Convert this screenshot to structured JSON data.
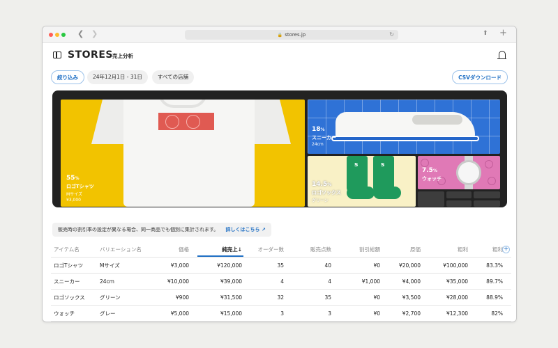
{
  "browser": {
    "url": "stores.jp",
    "colors": {
      "close": "#ff5f57",
      "minimize": "#febc2e",
      "zoom": "#28c840"
    }
  },
  "header": {
    "brand": "STORES",
    "subtitle": "売上分析"
  },
  "filters": {
    "narrow": "絞り込み",
    "date_range": "24年12月1日 - 31日",
    "store": "すべての店舗",
    "csv": "CSVダウンロード"
  },
  "treemap": [
    {
      "pct": "55",
      "unit": "%",
      "name": "ロゴTシャツ",
      "variation": "Mサイズ",
      "amount": "¥3,000"
    },
    {
      "pct": "18",
      "unit": "%",
      "name": "スニーカー",
      "variation": "24cm"
    },
    {
      "pct": "14.5",
      "unit": "%",
      "name": "ロゴソックス",
      "variation": "グリーン"
    },
    {
      "pct": "7.5",
      "unit": "%",
      "name": "ウォッチ"
    }
  ],
  "notice": {
    "text": "販売時の割引率の設定が異なる場合、同一商品でも個別に集計されます。",
    "link": "詳しくはこちら ↗"
  },
  "table": {
    "headers": [
      "アイテム名",
      "バリエーション名",
      "価格",
      "純売上↓",
      "オーダー数",
      "販売点数",
      "割引総額",
      "原価",
      "粗利",
      "粗利"
    ],
    "rows": [
      [
        "ロゴTシャツ",
        "Mサイズ",
        "¥3,000",
        "¥120,000",
        "35",
        "40",
        "¥0",
        "¥20,000",
        "¥100,000",
        "83.3%"
      ],
      [
        "スニーカー",
        "24cm",
        "¥10,000",
        "¥39,000",
        "4",
        "4",
        "¥1,000",
        "¥4,000",
        "¥35,000",
        "89.7%"
      ],
      [
        "ロゴソックス",
        "グリーン",
        "¥900",
        "¥31,500",
        "32",
        "35",
        "¥0",
        "¥3,500",
        "¥28,000",
        "88.9%"
      ],
      [
        "ウォッチ",
        "グレー",
        "¥5,000",
        "¥15,000",
        "3",
        "3",
        "¥0",
        "¥2,700",
        "¥12,300",
        "82%"
      ]
    ]
  },
  "accent_color": "#1f6fc4"
}
